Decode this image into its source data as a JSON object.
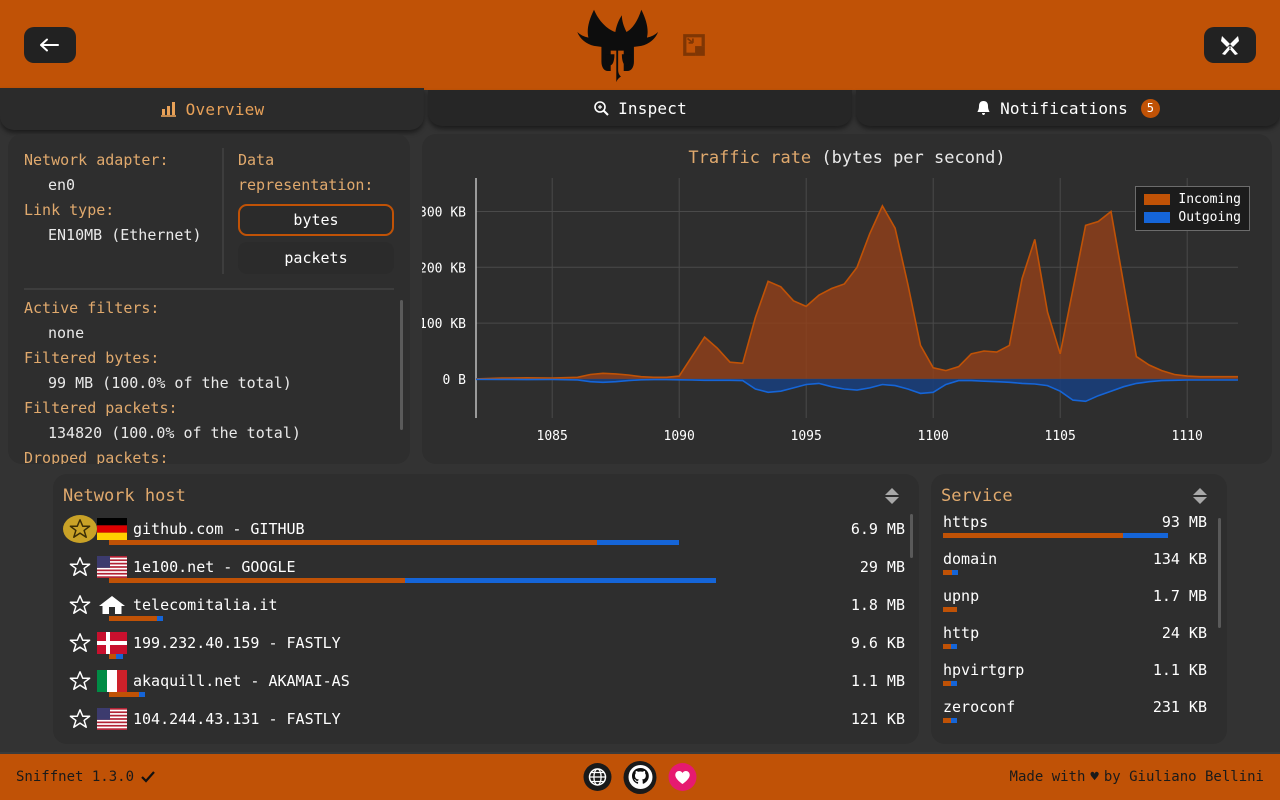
{
  "header": {
    "back_icon": "arrow-left-icon",
    "logo_icon": "sniffnet-dog-logo",
    "thumbnail_icon": "thumbnail-mode-icon",
    "settings_icon": "wrench-tools-icon"
  },
  "tabs": [
    {
      "label": "Overview",
      "icon": "bar-chart-icon",
      "active": true,
      "badge": ""
    },
    {
      "label": "Inspect",
      "icon": "magnifier-icon",
      "active": false,
      "badge": ""
    },
    {
      "label": "Notifications",
      "icon": "bell-icon",
      "active": false,
      "badge": "5"
    }
  ],
  "info": {
    "adapter_label": "Network adapter:",
    "adapter_value": "en0",
    "link_label": "Link type:",
    "link_value": "EN10MB (Ethernet)",
    "representation_label": "Data representation:",
    "representation_options": [
      "bytes",
      "packets"
    ],
    "representation_selected": "bytes",
    "filters_label": "Active filters:",
    "filters_value": "none",
    "filtered_bytes_label": "Filtered bytes:",
    "filtered_bytes_value": "99 MB (100.0% of the total)",
    "filtered_packets_label": "Filtered packets:",
    "filtered_packets_value": "134820 (100.0% of the total)",
    "dropped_label": "Dropped packets:"
  },
  "chart_data": {
    "type": "area",
    "title": "Traffic rate",
    "subtitle": "(bytes per second)",
    "xlabel": "",
    "ylabel": "",
    "ytick_labels": [
      "300 KB",
      "200 KB",
      "100 KB",
      "0 B"
    ],
    "ytick_values": [
      300000,
      200000,
      100000,
      0
    ],
    "xtick_labels": [
      "1085",
      "1090",
      "1095",
      "1100",
      "1105",
      "1110"
    ],
    "xtick_values": [
      1085,
      1090,
      1095,
      1100,
      1105,
      1110
    ],
    "xlim": [
      1082,
      1112
    ],
    "ylim": [
      -70000,
      360000
    ],
    "grid": true,
    "legend_position": "top-right",
    "legend": [
      "Incoming",
      "Outgoing"
    ],
    "colors": {
      "incoming": "#c05206",
      "outgoing": "#1565d8"
    },
    "x": [
      1082,
      1083,
      1084,
      1085,
      1086,
      1086.5,
      1087,
      1087.5,
      1088,
      1088.5,
      1089,
      1089.5,
      1090,
      1090.5,
      1091,
      1091.5,
      1092,
      1092.5,
      1093,
      1093.5,
      1094,
      1094.5,
      1095,
      1095.5,
      1096,
      1096.5,
      1097,
      1097.5,
      1098,
      1098.5,
      1099,
      1099.5,
      1100,
      1100.5,
      1101,
      1101.5,
      1102,
      1102.5,
      1103,
      1103.5,
      1104,
      1104.5,
      1105,
      1105.5,
      1106,
      1106.5,
      1107,
      1107.5,
      1108,
      1108.5,
      1109,
      1109.5,
      1110,
      1110.5,
      1111,
      1112
    ],
    "series": [
      {
        "name": "Incoming",
        "values": [
          0,
          1500,
          2000,
          1500,
          3000,
          8000,
          10000,
          9000,
          7000,
          4000,
          3000,
          3000,
          5000,
          40000,
          75000,
          55000,
          30000,
          28000,
          110000,
          175000,
          165000,
          140000,
          130000,
          150000,
          162000,
          170000,
          200000,
          260000,
          310000,
          270000,
          170000,
          60000,
          20000,
          15000,
          22000,
          45000,
          50000,
          48000,
          60000,
          180000,
          250000,
          120000,
          45000,
          160000,
          275000,
          282000,
          300000,
          170000,
          40000,
          25000,
          15000,
          8000,
          5000,
          4000,
          4000,
          4000
        ]
      },
      {
        "name": "Outgoing",
        "values": [
          -800,
          -900,
          -1200,
          -1000,
          -1800,
          -5000,
          -6000,
          -5000,
          -3000,
          -1500,
          -1200,
          -1200,
          -1500,
          -2000,
          -2500,
          -2500,
          -2500,
          -3000,
          -18000,
          -24000,
          -22000,
          -16000,
          -10000,
          -8000,
          -14000,
          -18000,
          -20000,
          -16000,
          -10000,
          -12000,
          -18000,
          -26000,
          -24000,
          -10000,
          -3000,
          -3000,
          -4000,
          -5000,
          -6000,
          -8000,
          -9000,
          -12000,
          -22000,
          -38000,
          -40000,
          -30000,
          -22000,
          -14000,
          -8000,
          -5000,
          -3000,
          -2500,
          -2000,
          -2000,
          -2000,
          -2000
        ]
      }
    ]
  },
  "host_list": {
    "title": "Network host",
    "sort_icon": "sort-updown-icon",
    "rows": [
      {
        "starred": true,
        "flag": "flag-germany",
        "name": "github.com - GITHUB",
        "value": "6.9 MB",
        "in_pct": 66,
        "out_pct": 11
      },
      {
        "starred": false,
        "flag": "flag-usa",
        "name": "1e100.net - GOOGLE",
        "value": "29 MB",
        "in_pct": 40,
        "out_pct": 42
      },
      {
        "starred": false,
        "flag": "home-icon",
        "name": "telecomitalia.it",
        "value": "1.8 MB",
        "in_pct": 6.5,
        "out_pct": 0.8
      },
      {
        "starred": false,
        "flag": "flag-denmark",
        "name": "199.232.40.159 - FASTLY",
        "value": "9.6 KB",
        "in_pct": 1.0,
        "out_pct": 0.9
      },
      {
        "starred": false,
        "flag": "flag-italy",
        "name": "akaquill.net - AKAMAI-AS",
        "value": "1.1 MB",
        "in_pct": 4.0,
        "out_pct": 0.8
      },
      {
        "starred": false,
        "flag": "flag-usa",
        "name": "104.244.43.131 - FASTLY",
        "value": "121 KB",
        "in_pct": 0,
        "out_pct": 0
      }
    ]
  },
  "service_list": {
    "title": "Service",
    "sort_icon": "sort-updown-icon",
    "rows": [
      {
        "name": "https",
        "value": "93 MB",
        "in_pct": 72,
        "out_pct": 18
      },
      {
        "name": "domain",
        "value": "134 KB",
        "in_pct": 3.5,
        "out_pct": 2.5
      },
      {
        "name": "upnp",
        "value": "1.7 MB",
        "in_pct": 5.5,
        "out_pct": 0
      },
      {
        "name": "http",
        "value": "24 KB",
        "in_pct": 3.0,
        "out_pct": 2.5
      },
      {
        "name": "hpvirtgrp",
        "value": "1.1 KB",
        "in_pct": 3.0,
        "out_pct": 2.5
      },
      {
        "name": "zeroconf",
        "value": "231 KB",
        "in_pct": 3.0,
        "out_pct": 2.5
      }
    ]
  },
  "footer": {
    "version": "Sniffnet 1.3.0",
    "version_check_icon": "checkmark-icon",
    "website_icon": "globe-icon",
    "github_icon": "github-icon",
    "sponsor_icon": "heart-icon",
    "made_with_prefix": "Made with",
    "made_with_heart": "♥",
    "made_with_suffix": "by Giuliano Bellini"
  },
  "colors": {
    "accent": "#c05206",
    "incoming": "#c05206",
    "outgoing": "#1565d8",
    "panel": "#2e2e2e",
    "page": "#333333",
    "label": "#e0a96d"
  }
}
